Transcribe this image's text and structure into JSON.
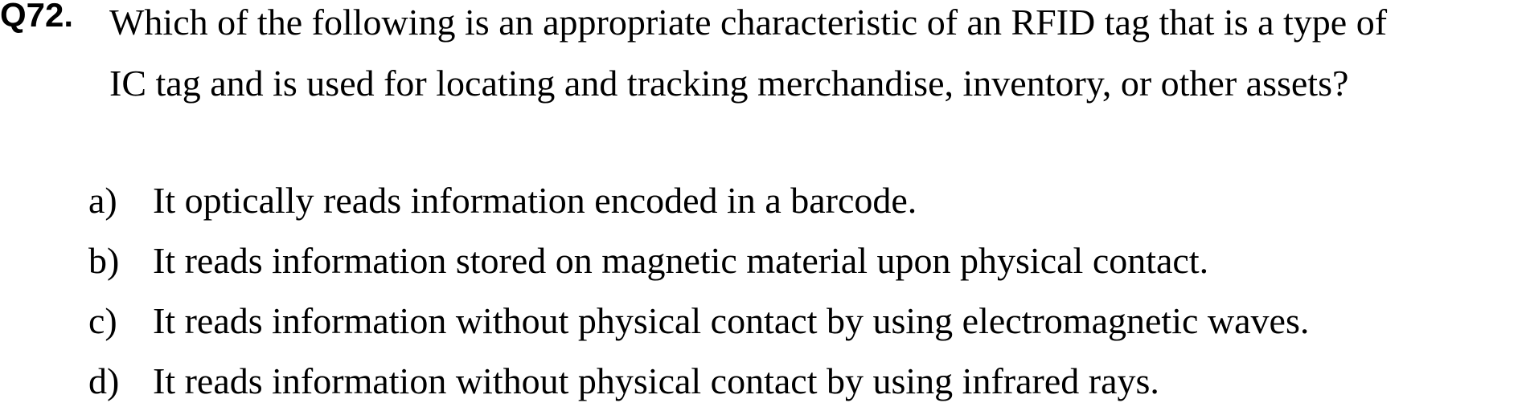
{
  "question": {
    "number": "Q72.",
    "lines": [
      "Which of the following is an appropriate characteristic of an RFID tag that is a type of",
      "IC tag and is used for locating and tracking merchandise, inventory, or other assets?"
    ]
  },
  "options": [
    {
      "letter": "a)",
      "text": "It optically reads information encoded in a barcode."
    },
    {
      "letter": "b)",
      "text": "It reads information stored on magnetic material upon physical contact."
    },
    {
      "letter": "c)",
      "text": "It reads information without physical contact by using electromagnetic waves."
    },
    {
      "letter": "d)",
      "text": "It reads information without physical contact by using infrared rays."
    }
  ]
}
